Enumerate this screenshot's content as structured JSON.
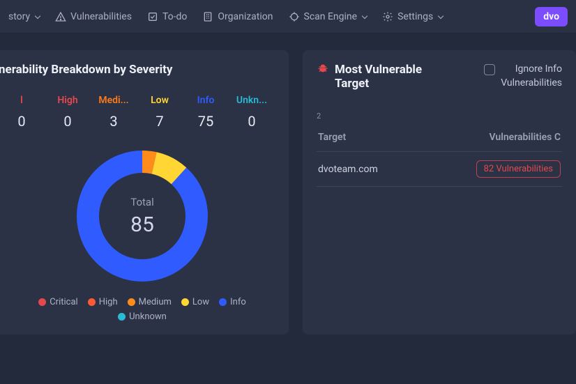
{
  "nav": {
    "items": [
      {
        "label": "story",
        "has_chevron": true
      },
      {
        "label": "Vulnerabilities"
      },
      {
        "label": "To-do"
      },
      {
        "label": "Organization"
      },
      {
        "label": "Scan Engine",
        "has_chevron": true
      },
      {
        "label": "Settings",
        "has_chevron": true
      }
    ],
    "brand_button": "dvo"
  },
  "left_card": {
    "title": "nerability Breakdown by Severity",
    "total_label": "Total",
    "total_value": "85",
    "severity": {
      "critical": {
        "label": "l",
        "count": "0"
      },
      "high": {
        "label": "High",
        "count": "0"
      },
      "medium": {
        "label": "Medi...",
        "count": "3"
      },
      "low": {
        "label": "Low",
        "count": "7"
      },
      "info": {
        "label": "Info",
        "count": "75"
      },
      "unknown": {
        "label": "Unkn...",
        "count": "0"
      }
    },
    "legend": {
      "critical": "Critical",
      "high": "High",
      "medium": "Medium",
      "low": "Low",
      "info": "Info",
      "unknown": "Unknown"
    }
  },
  "right_card": {
    "title": "Most Vulnerable Target",
    "ignore_label_l1": "Ignore Info",
    "ignore_label_l2": "Vulnerabilities",
    "table_index": "2",
    "columns": {
      "target": "Target",
      "vulns": "Vulnerabilities C"
    },
    "rows": [
      {
        "target": "dvoteam.com",
        "badge": "82 Vulnerabilities"
      }
    ]
  },
  "chart_data": {
    "type": "pie",
    "title": "Vulnerability Breakdown by Severity",
    "series": [
      {
        "name": "Critical",
        "value": 0,
        "color": "#e5484d"
      },
      {
        "name": "High",
        "value": 0,
        "color": "#ff5a36"
      },
      {
        "name": "Medium",
        "value": 3,
        "color": "#ff8c1a"
      },
      {
        "name": "Low",
        "value": 7,
        "color": "#ffd633"
      },
      {
        "name": "Info",
        "value": 75,
        "color": "#2f5bff"
      },
      {
        "name": "Unknown",
        "value": 0,
        "color": "#2bbad6"
      }
    ],
    "total": 85
  },
  "colors": {
    "critical": "#e5484d",
    "high": "#ff5a36",
    "medium": "#ff8c1a",
    "low": "#ffd633",
    "info": "#2f5bff",
    "unknown": "#2bbad6",
    "accent": "#7c4dff"
  }
}
